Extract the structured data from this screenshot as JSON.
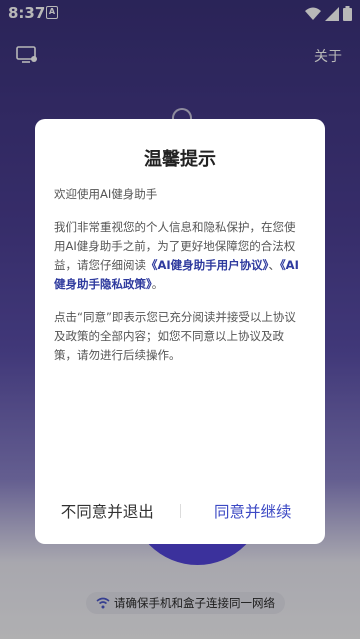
{
  "status_bar": {
    "time": "8:37",
    "app_icon_letter": "A"
  },
  "topbar": {
    "about_label": "关于"
  },
  "background": {
    "wifi_tip": "请确保手机和盒子连接同一网络"
  },
  "dialog": {
    "title": "温馨提示",
    "welcome": "欢迎使用AI健身助手",
    "para1_prefix": "我们非常重视您的个人信息和隐私保护，在您使用AI健身助手之前，为了更好地保障您的合法权益，请您仔细阅读",
    "user_agreement_link": "《AI健身助手用户协议》",
    "separator": "、",
    "privacy_policy_link": "《AI健身助手隐私政策》",
    "para1_suffix": "。",
    "para2": "点击“同意”即表示您已充分阅读并接受以上协议及政策的全部内容；如您不同意以上协议及政策，请勿进行后续操作。",
    "disagree_label": "不同意并退出",
    "agree_label": "同意并继续"
  },
  "colors": {
    "accent": "#3c49c4",
    "link": "#2e3a9e",
    "bg_top": "#3b327a"
  }
}
